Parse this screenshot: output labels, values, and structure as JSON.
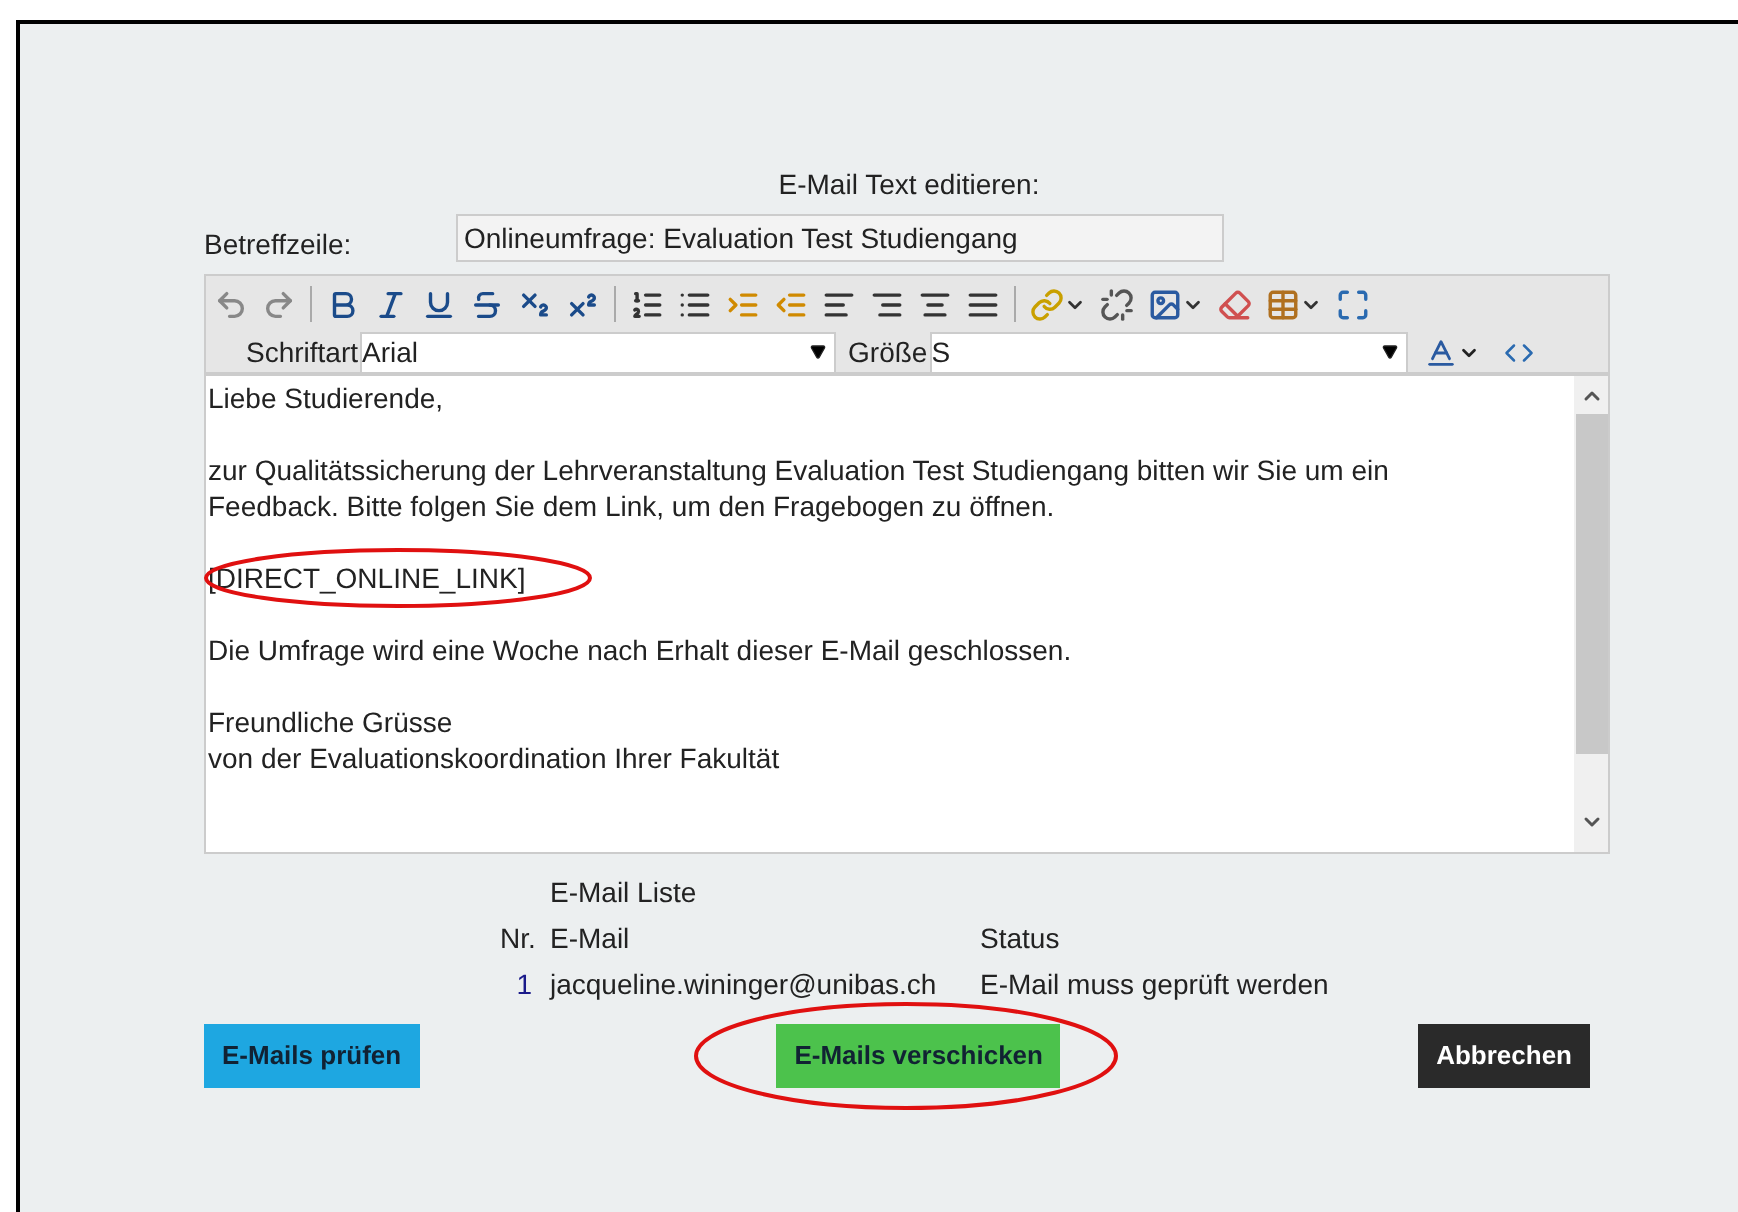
{
  "title": "E-Mail Text editieren:",
  "subject": {
    "label": "Betreffzeile:",
    "value": "Onlineumfrage: Evaluation Test Studiengang"
  },
  "toolbar": {
    "font_label": "Schriftart",
    "font_value": "Arial",
    "size_label": "Größe",
    "size_value": "S"
  },
  "body": [
    {
      "lines": [
        "Liebe Studierende,"
      ],
      "highlighted": false
    },
    {
      "lines": [
        "zur Qualitätssicherung der Lehrveranstaltung Evaluation Test Studiengang bitten wir Sie um ein Feedback. Bitte folgen Sie dem Link, um den Fragebogen zu öffnen."
      ],
      "highlighted": false
    },
    {
      "lines": [
        "[DIRECT_ONLINE_LINK]"
      ],
      "highlighted": true
    },
    {
      "lines": [
        "Die Umfrage wird eine Woche nach Erhalt dieser E-Mail geschlossen."
      ],
      "highlighted": false
    },
    {
      "lines": [
        "Freundliche Grüsse",
        "von der Evaluationskoordination Ihrer Fakultät"
      ],
      "highlighted": false
    }
  ],
  "email_list": {
    "title": "E-Mail Liste",
    "columns": [
      "Nr.",
      "E-Mail",
      "Status"
    ],
    "rows": [
      {
        "nr": "1",
        "email": "jacqueline.wininger@unibas.ch",
        "status": "E-Mail muss geprüft werden"
      }
    ]
  },
  "buttons": [
    {
      "label": "E-Mails prüfen",
      "kind": "check",
      "highlighted": false
    },
    {
      "label": "E-Mails verschicken",
      "kind": "send",
      "highlighted": true
    },
    {
      "label": "Abbrechen",
      "kind": "cancel",
      "highlighted": false
    }
  ]
}
